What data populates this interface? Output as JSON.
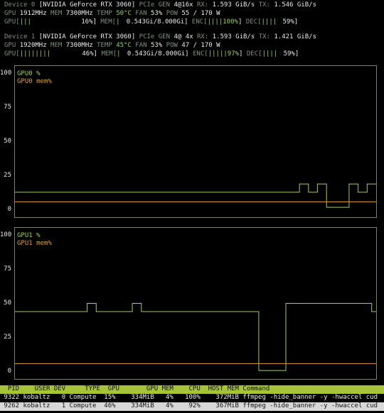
{
  "devices": [
    {
      "line1": {
        "device_label": "Device 0",
        "name": "[NVIDIA GeForce RTX 3060]",
        "pcie_label": "PCIe GEN",
        "pcie_value": "4@16x",
        "rx_label": "RX:",
        "rx_value": "1.593 GiB/s",
        "tx_label": "TX:",
        "tx_value": "1.546 GiB/s"
      },
      "line2": {
        "gpu_label": "GPU",
        "gpu_clock": "1912MHz",
        "mem_label": "MEM",
        "mem_clock": "7300MHz",
        "temp_label": "TEMP",
        "temp_value": " 50°C",
        "fan_label": "FAN",
        "fan_value": " 53%",
        "pow_label": "POW",
        "pow_value": " 55 / 170 W"
      },
      "line3": {
        "gpu_bar_label": "GPU[",
        "gpu_bar_fill": "|||",
        "gpu_bar_value": "16%]",
        "mem_bar_label": "MEM[",
        "mem_bar_fill": "|",
        "mem_bar_value": "0.543Gi/8.000Gi]",
        "enc_label": "ENC[",
        "enc_fill": "||||100%",
        "enc_close": "]",
        "dec_label": "DEC[",
        "dec_fill": "||||",
        "dec_value": "59%]"
      }
    },
    {
      "line1": {
        "device_label": "Device 1",
        "name": "[NVIDIA GeForce RTX 3060]",
        "pcie_label": "PCIe GEN",
        "pcie_value": "4@ 4x",
        "rx_label": "RX:",
        "rx_value": "1.593 GiB/s",
        "tx_label": "TX:",
        "tx_value": "1.421 GiB/s"
      },
      "line2": {
        "gpu_label": "GPU",
        "gpu_clock": "1920MHz",
        "mem_label": "MEM",
        "mem_clock": "7300MHz",
        "temp_label": "TEMP",
        "temp_value": " 45°C",
        "fan_label": "FAN",
        "fan_value": " 53%",
        "pow_label": "POW",
        "pow_value": " 47 / 170 W"
      },
      "line3": {
        "gpu_bar_label": "GPU[",
        "gpu_bar_fill": "||||||||",
        "gpu_bar_value": "46%]",
        "mem_bar_label": "MEM[",
        "mem_bar_fill": "|",
        "mem_bar_value": "0.543Gi/8.000Gi]",
        "enc_label": "ENC[",
        "enc_fill": "|||||97%",
        "enc_close": "]",
        "dec_label": "DEC[",
        "dec_fill": "||||",
        "dec_value": "59%]"
      }
    }
  ],
  "colors": {
    "green": "#9ecf5a",
    "orange": "#e0a030",
    "magenta": "#d070c8",
    "header_bg": "#a6c43a",
    "border": "#7f7f6a"
  },
  "chart_data": [
    {
      "type": "line",
      "yticks": [
        "100",
        "75",
        "50",
        "25",
        "0"
      ],
      "ylim": [
        0,
        100
      ],
      "grid": false,
      "legend_placement": "top-left",
      "x": [
        0,
        1,
        2,
        3,
        4,
        5,
        6,
        7,
        8,
        9,
        10,
        11,
        12,
        13,
        14,
        15,
        16,
        17,
        18,
        19,
        20,
        21,
        22,
        23,
        24,
        25,
        26,
        27,
        28,
        29,
        30,
        31,
        32,
        33,
        34,
        35,
        36,
        37,
        38,
        39,
        40,
        41,
        42,
        43,
        44,
        45,
        46,
        47,
        48,
        49,
        50,
        51,
        52,
        53,
        54,
        55,
        56,
        57,
        58,
        59,
        60,
        61,
        62,
        63,
        64,
        65,
        66,
        67,
        68,
        69,
        70,
        71,
        72,
        73,
        74,
        75,
        76,
        77,
        78,
        79,
        80
      ],
      "series": [
        {
          "name": "GPU0 %",
          "color": "#9ecf5a",
          "values": [
            13,
            13,
            13,
            13,
            13,
            13,
            13,
            13,
            13,
            13,
            13,
            13,
            13,
            13,
            13,
            13,
            13,
            13,
            13,
            13,
            13,
            13,
            13,
            13,
            13,
            13,
            13,
            13,
            13,
            13,
            13,
            13,
            13,
            13,
            13,
            13,
            13,
            13,
            13,
            13,
            13,
            13,
            13,
            13,
            13,
            13,
            13,
            13,
            13,
            13,
            13,
            13,
            13,
            13,
            13,
            13,
            13,
            13,
            13,
            13,
            13,
            13,
            13,
            19,
            19,
            13,
            13,
            19,
            19,
            2,
            2,
            2,
            2,
            2,
            19,
            19,
            13,
            13,
            19,
            19,
            19
          ]
        },
        {
          "name": "GPU0 mem%",
          "color": "#e0a030",
          "values": [
            6,
            6,
            6,
            6,
            6,
            6,
            6,
            6,
            6,
            6,
            6,
            6,
            6,
            6,
            6,
            6,
            6,
            6,
            6,
            6,
            6,
            6,
            6,
            6,
            6,
            6,
            6,
            6,
            6,
            6,
            6,
            6,
            6,
            6,
            6,
            6,
            6,
            6,
            6,
            6,
            6,
            6,
            6,
            6,
            6,
            6,
            6,
            6,
            6,
            6,
            6,
            6,
            6,
            6,
            6,
            6,
            6,
            6,
            6,
            6,
            6,
            6,
            6,
            6,
            6,
            6,
            6,
            6,
            6,
            6,
            6,
            6,
            6,
            6,
            6,
            6,
            6,
            6,
            6,
            6,
            6
          ]
        }
      ]
    },
    {
      "type": "line",
      "yticks": [
        "100",
        "75",
        "50",
        "25",
        "0"
      ],
      "ylim": [
        0,
        100
      ],
      "grid": false,
      "legend_placement": "top-left",
      "x": [
        0,
        1,
        2,
        3,
        4,
        5,
        6,
        7,
        8,
        9,
        10,
        11,
        12,
        13,
        14,
        15,
        16,
        17,
        18,
        19,
        20,
        21,
        22,
        23,
        24,
        25,
        26,
        27,
        28,
        29,
        30,
        31,
        32,
        33,
        34,
        35,
        36,
        37,
        38,
        39,
        40,
        41,
        42,
        43,
        44,
        45,
        46,
        47,
        48,
        49,
        50,
        51,
        52,
        53,
        54,
        55,
        56,
        57,
        58,
        59,
        60,
        61,
        62,
        63,
        64,
        65,
        66,
        67,
        68,
        69,
        70,
        71,
        72,
        73,
        74,
        75,
        76,
        77,
        78,
        79,
        80
      ],
      "series": [
        {
          "name": "GPU1 %",
          "color": "#9ecf5a",
          "values": [
            44,
            44,
            44,
            44,
            44,
            44,
            44,
            44,
            44,
            44,
            44,
            44,
            44,
            44,
            44,
            44,
            50,
            50,
            44,
            44,
            44,
            44,
            44,
            44,
            44,
            44,
            50,
            50,
            44,
            44,
            44,
            44,
            44,
            44,
            44,
            44,
            44,
            44,
            44,
            44,
            44,
            44,
            44,
            44,
            44,
            44,
            44,
            44,
            44,
            44,
            44,
            44,
            44,
            44,
            1,
            1,
            1,
            1,
            1,
            1,
            50,
            50,
            50,
            50,
            50,
            50,
            50,
            50,
            50,
            50,
            50,
            50,
            50,
            50,
            50,
            50,
            50,
            50,
            50,
            44,
            44
          ]
        },
        {
          "name": "GPU1 mem%",
          "color": "#e0a030",
          "values": [
            6,
            6,
            6,
            6,
            6,
            6,
            6,
            6,
            6,
            6,
            6,
            6,
            6,
            6,
            6,
            6,
            6,
            6,
            6,
            6,
            6,
            6,
            6,
            6,
            6,
            6,
            6,
            6,
            6,
            6,
            6,
            6,
            6,
            6,
            6,
            6,
            6,
            6,
            6,
            6,
            6,
            6,
            6,
            6,
            6,
            6,
            6,
            6,
            6,
            6,
            6,
            6,
            6,
            6,
            6,
            6,
            6,
            6,
            6,
            6,
            6,
            6,
            6,
            6,
            6,
            6,
            6,
            6,
            6,
            6,
            6,
            6,
            6,
            6,
            6,
            6,
            6,
            6,
            6,
            6,
            6
          ]
        }
      ]
    }
  ],
  "process_table": {
    "header": "  PID    USER DEV     TYPE  GPU       GPU MEM    CPU  HOST MEM Command",
    "rows": [
      " 9322 kobaltz   0 Compute  15%    334MiB   4%   100%    372MiB ffmpeg -hide_banner -y -hwaccel cud",
      " 9262 kobaltz   1 Compute  46%    334MiB   4%    92%    367MiB ffmpeg -hide_banner -y -hwaccel cud"
    ]
  }
}
